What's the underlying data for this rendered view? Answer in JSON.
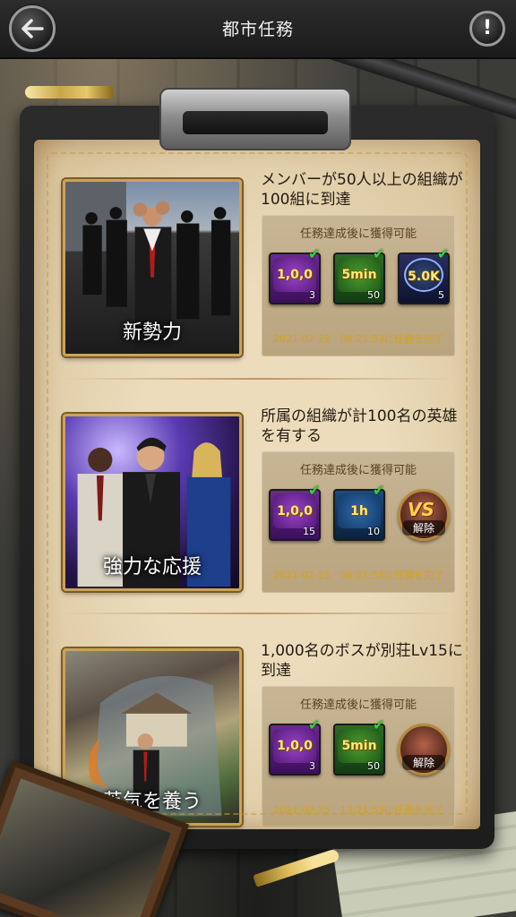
{
  "header": {
    "title": "都市任務",
    "back_icon": "arrow-left-icon",
    "info_label": "!"
  },
  "colors": {
    "header_bg": "#1f1f1f",
    "paper": "#e7d6b3",
    "reward_box": "#c0ad88",
    "completed_text": "#d7a11b",
    "check": "#38d13a"
  },
  "missions": [
    {
      "title": "メンバーが50人以上の組織が100組に到達",
      "image_caption": "新勢力",
      "reward_header": "任務達成後に獲得可能",
      "completed_text": "2021-02-23　06:21:53に任務を完了",
      "rewards": [
        {
          "face": "1,0,0",
          "count": "3",
          "icon": "purple-coupon-icon"
        },
        {
          "face": "5min",
          "count": "50",
          "icon": "green-speedup-icon"
        },
        {
          "face": "5.0K",
          "count": "5",
          "icon": "blue-resource-icon"
        }
      ]
    },
    {
      "title": "所属の組織が計100名の英雄を有する",
      "image_caption": "強力な応援",
      "reward_header": "任務達成後に獲得可能",
      "completed_text": "2021-02-25　06:21:53に任務を完了",
      "rewards": [
        {
          "face": "1,0,0",
          "count": "15",
          "icon": "purple-coupon-icon"
        },
        {
          "face": "1h",
          "count": "10",
          "icon": "blue-speedup-icon"
        },
        {
          "face": "VS",
          "label": "解除",
          "icon": "hero-unlock-icon"
        }
      ]
    },
    {
      "title": "1,000名のボスが別荘Lv15に到達",
      "image_caption": "英気を養う",
      "reward_header": "任務達成後に獲得可能",
      "completed_text": "2021-02-25　13:21:53に任務を完了",
      "rewards": [
        {
          "face": "1,0,0",
          "count": "3",
          "icon": "purple-coupon-icon"
        },
        {
          "face": "5min",
          "count": "50",
          "icon": "green-speedup-icon"
        },
        {
          "face": "",
          "label": "解除",
          "icon": "hero-unlock-icon"
        }
      ]
    }
  ]
}
